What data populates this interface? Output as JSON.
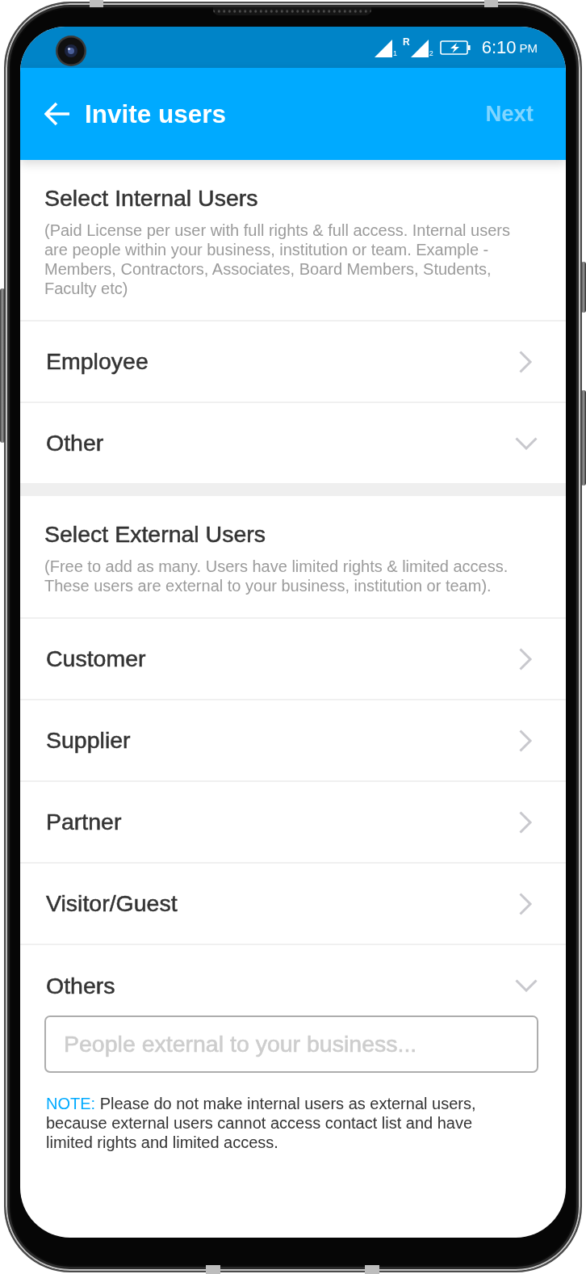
{
  "status_bar": {
    "signals": [
      {
        "sim": "1"
      },
      {
        "sim": "2",
        "roaming": "R"
      }
    ],
    "battery": {
      "charging": true
    },
    "time": "6:10",
    "period": "PM"
  },
  "app_bar": {
    "title": "Invite users",
    "next": {
      "label": "Next",
      "disabled": true
    }
  },
  "sections": [
    {
      "title": "Select Internal Users",
      "description": "(Paid License per user with full rights & full access. Internal users are people within your business, institution or team. Example - Members, Contractors, Associates, Board Members, Students, Faculty etc)",
      "items": [
        {
          "label": "Employee",
          "kind": "link"
        },
        {
          "label": "Other",
          "kind": "dropdown"
        }
      ]
    },
    {
      "title": "Select External Users",
      "description": "(Free to add as many. Users have limited rights & limited access. These users are external to your business, institution or team).",
      "items": [
        {
          "label": "Customer",
          "kind": "link"
        },
        {
          "label": "Supplier",
          "kind": "link"
        },
        {
          "label": "Partner",
          "kind": "link"
        },
        {
          "label": "Visitor/Guest",
          "kind": "link"
        },
        {
          "label": "Others",
          "kind": "dropdown",
          "field": {
            "placeholder": "People external to your business..."
          }
        }
      ]
    }
  ],
  "note": {
    "label": "NOTE:",
    "text": "Please do not make internal users as external users, because external users cannot access contact list and have limited rights and limited access."
  }
}
